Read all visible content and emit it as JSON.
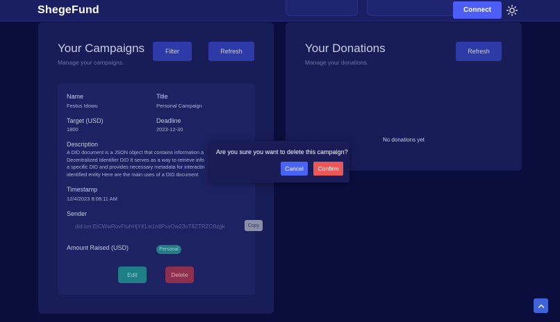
{
  "header": {
    "brand": "ShegeFund",
    "connect_label": "Connect",
    "theme_icon": "sun-icon"
  },
  "campaigns": {
    "title": "Your Campaigns",
    "subtitle": "Manage your campaigns.",
    "filter_label": "Filter",
    "refresh_label": "Refresh",
    "card": {
      "name_label": "Name",
      "name_value": "Festus Idowu",
      "title_label": "Title",
      "title_value": "Personal Campaign",
      "target_label": "Target (USD)",
      "target_value": "1800",
      "deadline_label": "Deadline",
      "deadline_value": "2023-12-30",
      "description_label": "Description",
      "description_lines": [
        "A DID document is a JSON object that contains information a",
        "Decentralized Identifier DID It serves as a way to retrieve info",
        "a specific DID and provides necessary metadata for interactin",
        "identified entity Here are the main uses of a DID document"
      ],
      "timestamp_label": "Timestamp",
      "timestamp_value": "12/4/2023 8:08:11 AM",
      "sender_label": "Sender",
      "sender_value": "did:ion:EiCWwRovFtuhHjYKLw1n8PxsOw23oT8ZTRZO9zgk",
      "copy_label": "Copy",
      "amount_label": "Amount Raised (USD)",
      "tag": "Personal",
      "edit_label": "Edit",
      "delete_label": "Delete"
    }
  },
  "donations": {
    "title": "Your Donations",
    "subtitle": "Manage your donations.",
    "refresh_label": "Refresh",
    "empty_text": "No donations yet"
  },
  "modal": {
    "message": "Are you sure you want to delete this campaign?",
    "cancel_label": "Cancel",
    "confirm_label": "Confirm"
  },
  "scroll_top_icon": "arrow-up-icon"
}
